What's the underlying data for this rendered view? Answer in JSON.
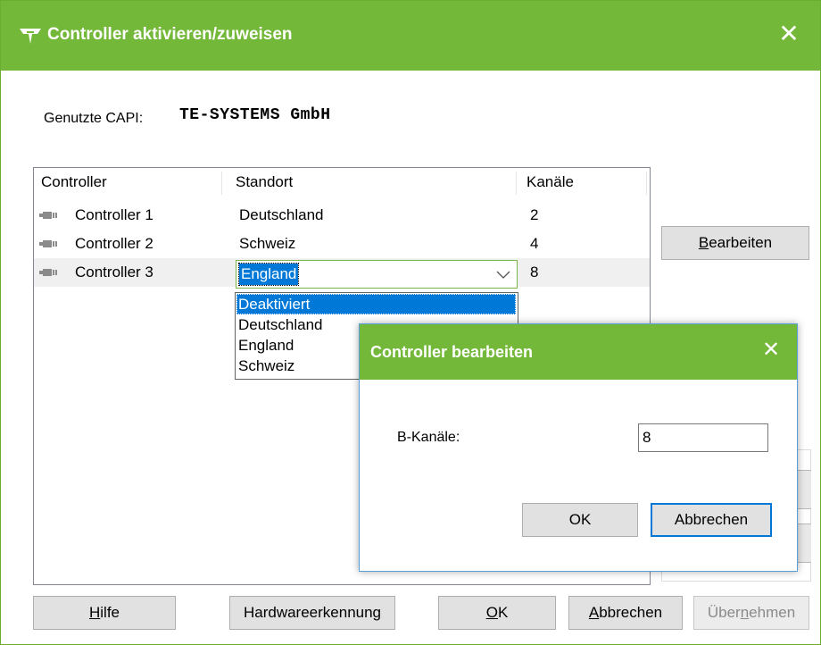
{
  "window": {
    "title": "Controller aktivieren/zuweisen",
    "icon": "capi-plug-icon",
    "accent_color": "#74b83a"
  },
  "capi": {
    "label": "Genutzte CAPI:",
    "value": "TE-SYSTEMS GmbH"
  },
  "table": {
    "columns": [
      "Controller",
      "Standort",
      "Kanäle"
    ],
    "rows": [
      {
        "controller": "Controller 1",
        "standort": "Deutschland",
        "kanaele": "2"
      },
      {
        "controller": "Controller 2",
        "standort": "Schweiz",
        "kanaele": "4"
      },
      {
        "controller": "Controller 3",
        "standort": "England",
        "kanaele": "8"
      }
    ],
    "selected_row": 3
  },
  "dropdown": {
    "value": "England",
    "options": [
      "Deaktiviert",
      "Deutschland",
      "England",
      "Schweiz"
    ],
    "highlighted": "Deaktiviert"
  },
  "buttons": {
    "edit": {
      "prefix": "",
      "mnemonic": "B",
      "rest": "earbeiten"
    },
    "help": {
      "prefix": "",
      "mnemonic": "H",
      "rest": "ilfe"
    },
    "hardware": {
      "label": "Hardwareerkennung"
    },
    "ok": {
      "prefix": "",
      "mnemonic": "O",
      "rest": "K"
    },
    "cancel": {
      "prefix": "",
      "mnemonic": "A",
      "rest": "bbrechen"
    },
    "apply": {
      "prefix": "Über",
      "mnemonic": "n",
      "rest": "ehmen"
    }
  },
  "dialog": {
    "title": "Controller bearbeiten",
    "field_label": "B-Kanäle:",
    "field_value": "8",
    "ok_label": "OK",
    "cancel_label": "Abbrechen"
  }
}
